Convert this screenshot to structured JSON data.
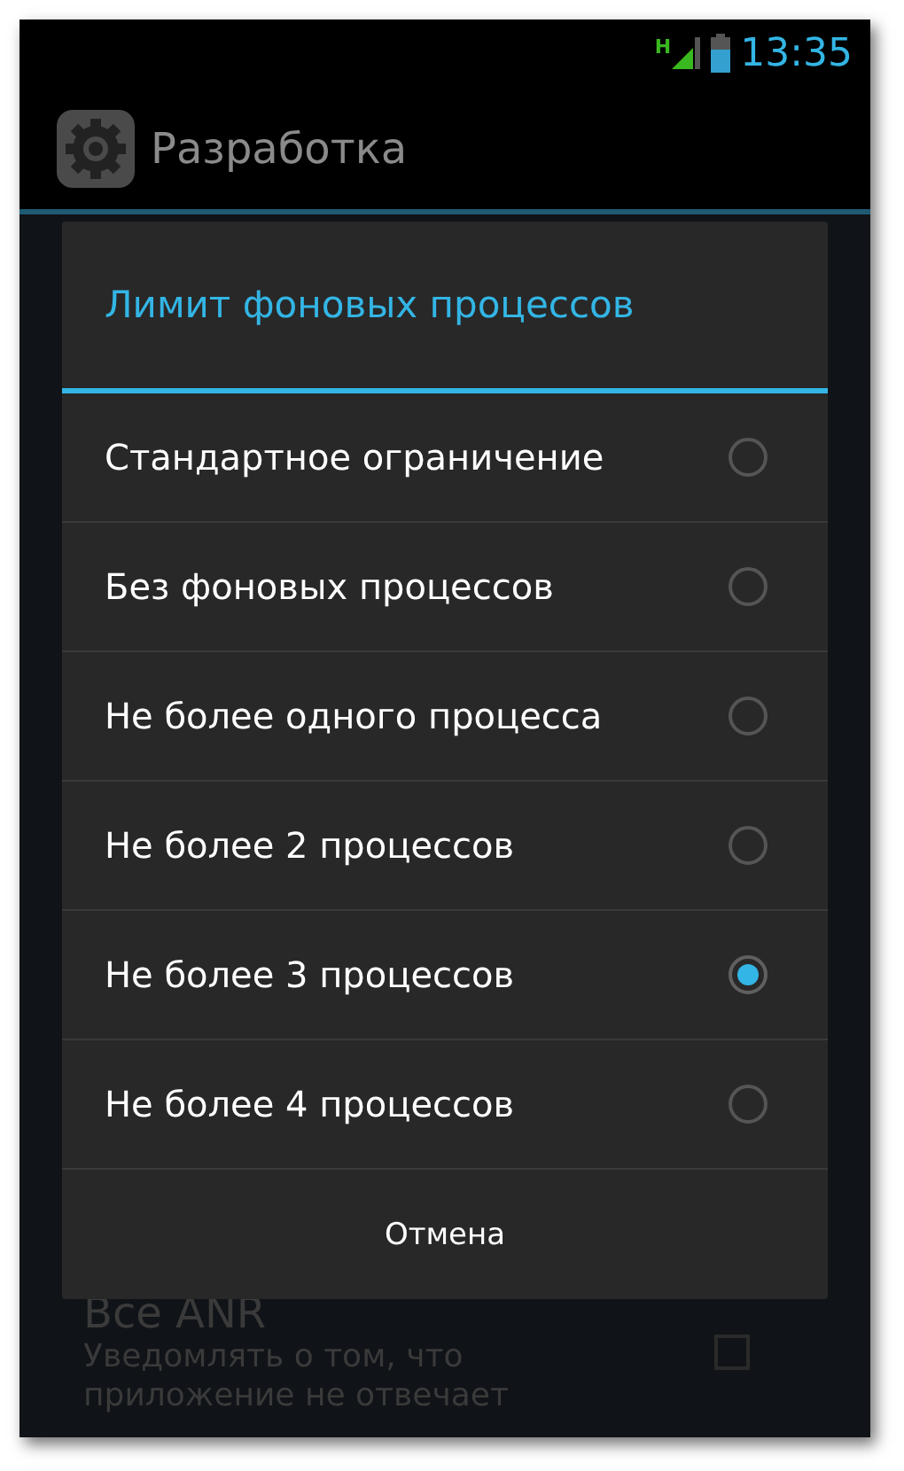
{
  "status_bar": {
    "network": "H",
    "time": "13:35"
  },
  "action_bar": {
    "title": "Разработка"
  },
  "background_preference": {
    "title": "Все ANR",
    "summary": "Уведомлять о том, что приложение не отвечает",
    "checked": false
  },
  "dialog": {
    "title": "Лимит фоновых процессов",
    "options": [
      {
        "label": "Стандартное ограничение",
        "selected": false
      },
      {
        "label": "Без фоновых процессов",
        "selected": false
      },
      {
        "label": "Не более одного процесса",
        "selected": false
      },
      {
        "label": "Не более 2 процессов",
        "selected": false
      },
      {
        "label": "Не более 3 процессов",
        "selected": true
      },
      {
        "label": "Не более 4 процессов",
        "selected": false
      }
    ],
    "button": "Отмена"
  }
}
